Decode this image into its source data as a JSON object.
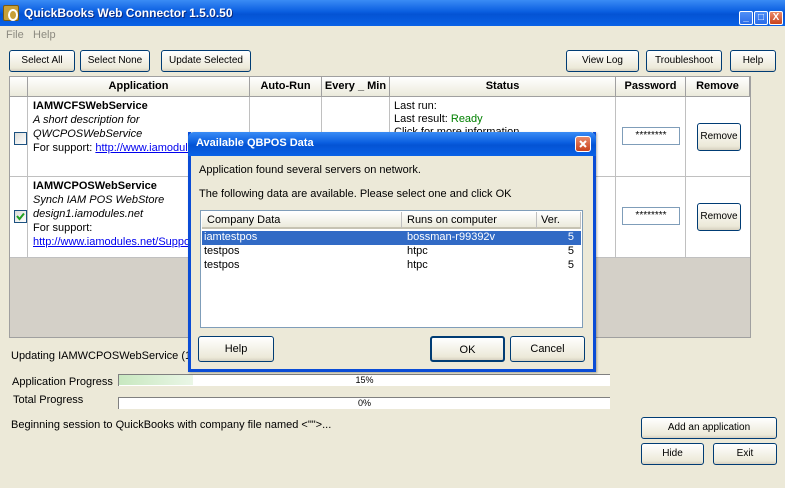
{
  "window": {
    "title": "QuickBooks Web Connector 1.5.0.50",
    "minimize": "_",
    "maximize": "□",
    "close": "X"
  },
  "menu": [
    "File",
    "Help"
  ],
  "toolbar": {
    "select_all": "Select All",
    "select_none": "Select None",
    "update_selected": "Update Selected",
    "view_log": "View Log",
    "troubleshoot": "Troubleshoot",
    "help": "Help"
  },
  "grid": {
    "columns": [
      "Application",
      "Auto-Run",
      "Every _ Min",
      "Status",
      "Password",
      "Remove"
    ],
    "rows": [
      {
        "name": "IAMWCFSWebService",
        "desc1": "A short description for",
        "desc2": "QWCPOSWebService",
        "support_label": "For support:",
        "support_link": "http://www.iamodules.net",
        "status1": "Last run:",
        "status2_label": "Last result:",
        "status2_value": "Ready",
        "status3": "Click for more information",
        "checked": false,
        "password": "********",
        "remove": "Remove"
      },
      {
        "name": "IAMWCPOSWebService",
        "desc1": "Synch IAM POS WebStore",
        "desc2": "design1.iamodules.net",
        "support_label": "For support:",
        "support_link": "http://www.iamodules.net/Support",
        "checked": true,
        "password": "********",
        "remove": "Remove"
      }
    ]
  },
  "progress": {
    "updating_text": "Updating IAMWCPOSWebService (1",
    "app_label": "Application Progress",
    "app_value": "15%",
    "app_fraction": 0.15,
    "total_label": "Total Progress",
    "total_value": "0%",
    "total_fraction": 0,
    "session_text": "Beginning session to QuickBooks with company file named <\"\">..."
  },
  "bottom_buttons": {
    "add": "Add an application",
    "hide": "Hide",
    "exit": "Exit"
  },
  "dialog": {
    "title": "Available QBPOS Data",
    "line1": "Application found several servers on network.",
    "line2": "The following data are available. Please select one and click OK",
    "columns": [
      "Company Data",
      "Runs on computer",
      "Ver."
    ],
    "rows": [
      {
        "company": "iamtestpos",
        "computer": "bossman-r99392v",
        "ver": "5",
        "selected": true
      },
      {
        "company": "testpos",
        "computer": "htpc",
        "ver": "5",
        "selected": false
      },
      {
        "company": "testpos",
        "computer": "htpc",
        "ver": "5",
        "selected": false
      }
    ],
    "help": "Help",
    "ok": "OK",
    "cancel": "Cancel"
  },
  "colors": {
    "titlebar": "#0a5ee0",
    "selection": "#316ac5",
    "status_ready": "#008000"
  }
}
